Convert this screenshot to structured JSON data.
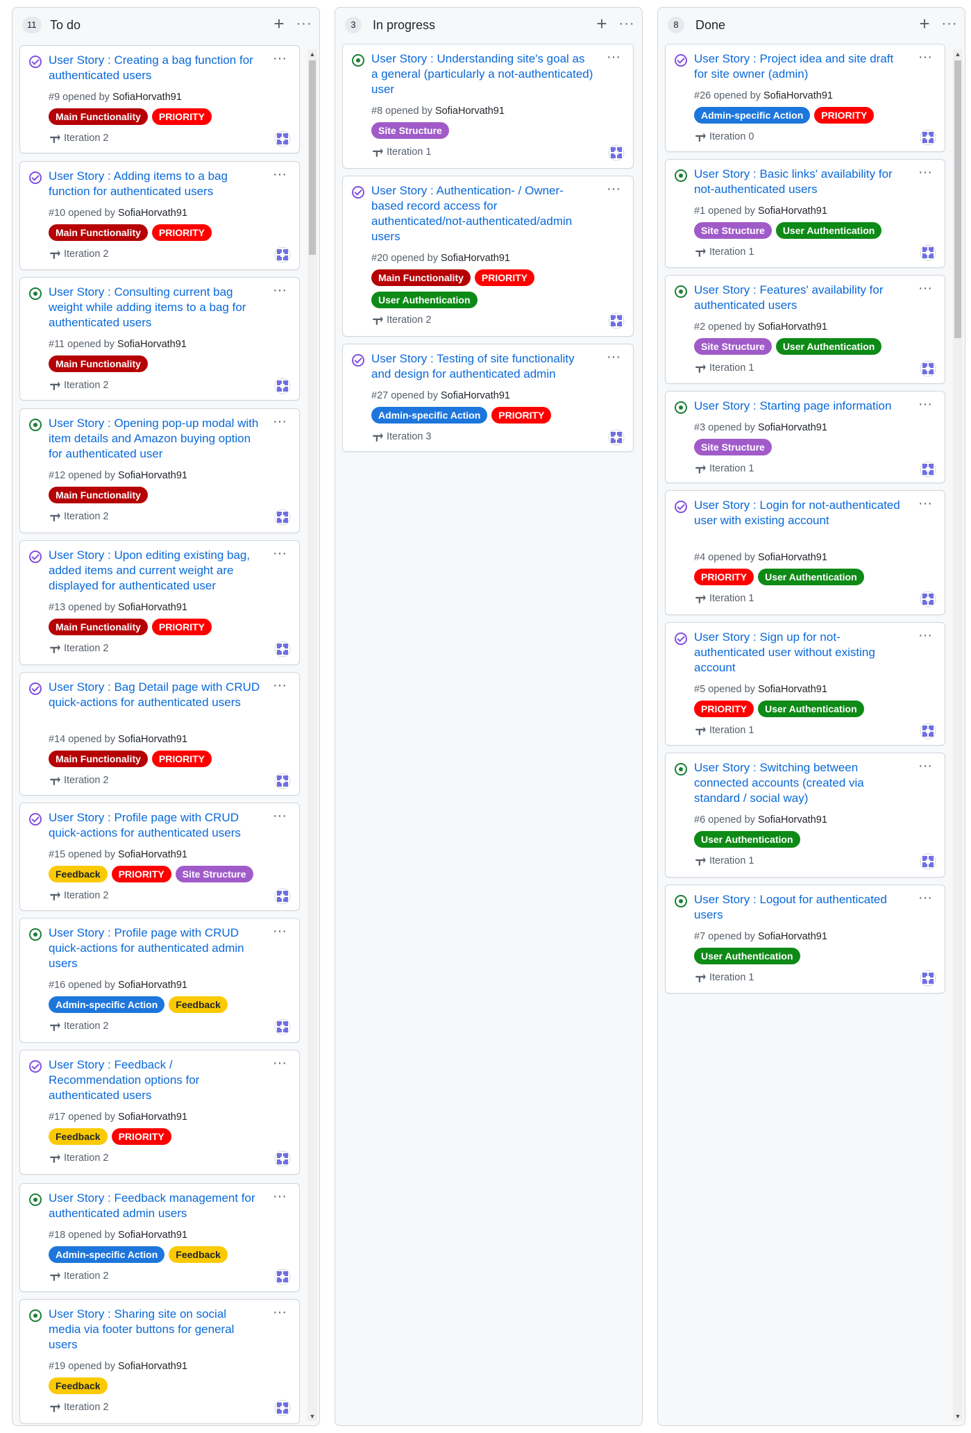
{
  "colors": {
    "main_functionality": "#b60205",
    "priority": "#ff0000",
    "site_structure": "#a05bc9",
    "user_authentication": "#0e8a16",
    "admin_specific_action": "#1d76db",
    "feedback": "#fbca04"
  },
  "columns": [
    {
      "count": "11",
      "title": "To do",
      "cards": [
        {
          "title": "User Story : Creating a bag function for authenticated users",
          "number": "#9",
          "opened_by": "opened by",
          "author": "SofiaHorvath91",
          "iteration": "Iteration 2"
        },
        {
          "title": "User Story : Adding items to a bag function for authenticated users",
          "number": "#10",
          "opened_by": "opened by",
          "author": "SofiaHorvath91",
          "iteration": "Iteration 2"
        },
        {
          "title": "User Story : Consulting current bag weight while adding items to a bag for authenticated users",
          "number": "#11",
          "opened_by": "opened by",
          "author": "SofiaHorvath91",
          "iteration": "Iteration 2"
        },
        {
          "title": "User Story : Opening pop-up modal with item details and Amazon buying option for authenticated user",
          "number": "#12",
          "opened_by": "opened by",
          "author": "SofiaHorvath91",
          "iteration": "Iteration 2"
        },
        {
          "title": "User Story : Upon editing existing bag, added items and current weight are displayed for authenticated user",
          "number": "#13",
          "opened_by": "opened by",
          "author": "SofiaHorvath91",
          "iteration": "Iteration 2"
        },
        {
          "title": "User Story : Bag Detail page with CRUD quick-actions for authenticated users",
          "number": "#14",
          "opened_by": "opened by",
          "author": "SofiaHorvath91",
          "iteration": "Iteration 2"
        },
        {
          "title": "User Story : Profile page with CRUD quick-actions for authenticated users",
          "number": "#15",
          "opened_by": "opened by",
          "author": "SofiaHorvath91",
          "iteration": "Iteration 2"
        },
        {
          "title": "User Story : Profile page with CRUD quick-actions for authenticated admin users",
          "number": "#16",
          "opened_by": "opened by",
          "author": "SofiaHorvath91",
          "iteration": "Iteration 2"
        },
        {
          "title": "User Story : Feedback / Recommendation options for authenticated users",
          "number": "#17",
          "opened_by": "opened by",
          "author": "SofiaHorvath91",
          "iteration": "Iteration 2"
        },
        {
          "title": "User Story : Feedback management for authenticated admin users",
          "number": "#18",
          "opened_by": "opened by",
          "author": "SofiaHorvath91",
          "iteration": "Iteration 2"
        },
        {
          "title": "User Story : Sharing site on social media via footer buttons for general users",
          "number": "#19",
          "opened_by": "opened by",
          "author": "SofiaHorvath91",
          "iteration": "Iteration 2"
        }
      ]
    },
    {
      "count": "3",
      "title": "In progress",
      "cards": [
        {
          "title": "User Story : Understanding site's goal as a general (particularly a not-authenticated) user",
          "number": "#8",
          "opened_by": "opened by",
          "author": "SofiaHorvath91",
          "iteration": "Iteration 1"
        },
        {
          "title": "User Story : Authentication- / Owner-based record access for authenticated/not-authenticated/admin users",
          "number": "#20",
          "opened_by": "opened by",
          "author": "SofiaHorvath91",
          "iteration": "Iteration 2"
        },
        {
          "title": "User Story : Testing of site functionality and design for authenticated admin",
          "number": "#27",
          "opened_by": "opened by",
          "author": "SofiaHorvath91",
          "iteration": "Iteration 3"
        }
      ]
    },
    {
      "count": "8",
      "title": "Done",
      "cards": [
        {
          "title": "User Story : Project idea and site draft for site owner (admin)",
          "number": "#26",
          "opened_by": "opened by",
          "author": "SofiaHorvath91",
          "iteration": "Iteration 0"
        },
        {
          "title": "User Story : Basic links' availability for not-authenticated users",
          "number": "#1",
          "opened_by": "opened by",
          "author": "SofiaHorvath91",
          "iteration": "Iteration 1"
        },
        {
          "title": "User Story : Features' availability for authenticated users",
          "number": "#2",
          "opened_by": "opened by",
          "author": "SofiaHorvath91",
          "iteration": "Iteration 1"
        },
        {
          "title": "User Story : Starting page information",
          "number": "#3",
          "opened_by": "opened by",
          "author": "SofiaHorvath91",
          "iteration": "Iteration 1"
        },
        {
          "title": "User Story : Login for not-authenticated user with existing account",
          "number": "#4",
          "opened_by": "opened by",
          "author": "SofiaHorvath91",
          "iteration": "Iteration 1"
        },
        {
          "title": "User Story : Sign up for not-authenticated user without existing account",
          "number": "#5",
          "opened_by": "opened by",
          "author": "SofiaHorvath91",
          "iteration": "Iteration 1"
        },
        {
          "title": "User Story : Switching between connected accounts (created via standard / social way)",
          "number": "#6",
          "opened_by": "opened by",
          "author": "SofiaHorvath91",
          "iteration": "Iteration 1"
        },
        {
          "title": "User Story : Logout for authenticated users",
          "number": "#7",
          "opened_by": "opened by",
          "author": "SofiaHorvath91",
          "iteration": "Iteration 1"
        }
      ]
    }
  ],
  "labels": {
    "main": "Main Functionality",
    "priority": "PRIORITY",
    "site": "Site Structure",
    "auth": "User Authentication",
    "admin": "Admin-specific Action",
    "feedback": "Feedback"
  },
  "icons": {
    "add": "plus-icon",
    "more": "kebab-horizontal-icon",
    "status_open": "issue-opened-icon",
    "status_closed": "issue-closed-icon",
    "iteration": "iterations-icon",
    "avatar": "identicon-avatar"
  }
}
